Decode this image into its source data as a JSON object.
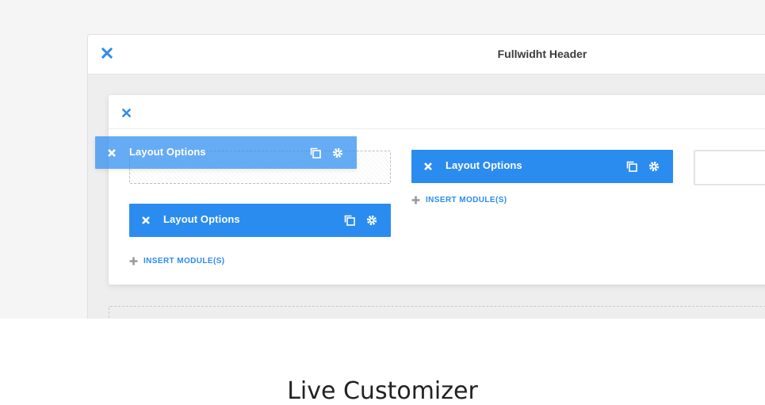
{
  "section": {
    "title": "Fullwidht Header"
  },
  "modules": [
    {
      "label": "Layout Options"
    },
    {
      "label": "Layout Options"
    },
    {
      "label": "Layout Options"
    }
  ],
  "insert_links": [
    {
      "label": "INSERT MODULE(S)"
    },
    {
      "label": "INSERT MODULE(S)"
    }
  ],
  "caption": "Live Customizer",
  "colors": {
    "accent": "#2b8cf0",
    "background": "#f5f5f5",
    "panel": "#eeeeee"
  },
  "icons": [
    "close-icon",
    "duplicate-icon",
    "gear-icon",
    "plus-icon"
  ]
}
